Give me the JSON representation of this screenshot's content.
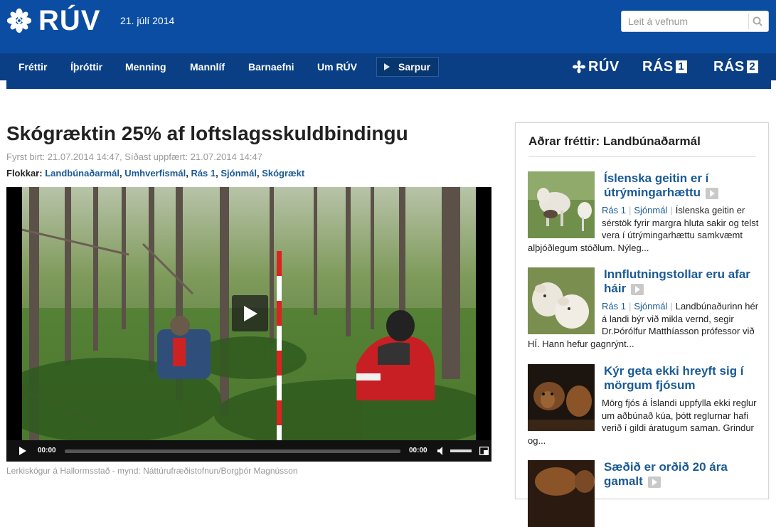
{
  "header": {
    "logo_text": "RÚV",
    "date": "21. júlí 2014",
    "search_placeholder": "Leit á vefnum"
  },
  "nav": {
    "items": [
      "Fréttir",
      "Íþróttir",
      "Menning",
      "Mannlíf",
      "Barnaefni",
      "Um RÚV"
    ],
    "sarpur": "Sarpur",
    "brands": {
      "ruv": "RÚV",
      "ras1": "RÁS",
      "ras1_num": "1",
      "ras2": "RÁS",
      "ras2_num": "2"
    }
  },
  "article": {
    "title": "Skógræktin 25% af loftslagsskuldbindingu",
    "meta": "Fyrst birt: 21.07.2014 14:47, Síðast uppfært: 21.07.2014 14:47",
    "categories_label": "Flokkar:",
    "categories": [
      "Landbúnaðarmál",
      "Umhverfismál",
      "Rás 1",
      "Sjónmál",
      "Skógrækt"
    ],
    "video": {
      "time_current": "00:00",
      "time_total": "00:00",
      "progress": 0
    },
    "caption": "Lerkiskógur á Hallormsstað - mynd: Náttúrufræðistofnun/Borgþór Magnússon"
  },
  "sidebar": {
    "title": "Aðrar fréttir: Landbúnaðarmál",
    "stories": [
      {
        "title": "Íslenska geitin er í útrýmingarhættu",
        "tags": [
          "Rás 1",
          "Sjónmál"
        ],
        "body": "Íslenska geitin er sérstök fyrir margra hluta sakir og telst vera í útrýmingarhættu samkvæmt alþjóðlegum stöðlum. Nýleg..."
      },
      {
        "title": "Innflutningstollar eru afar háir",
        "tags": [
          "Rás 1",
          "Sjónmál"
        ],
        "body": "Landbúnaðurinn hér á landi býr við mikla vernd, segir Dr.Þórólfur Matthíasson prófessor við HÍ. Hann hefur gagnrýnt..."
      },
      {
        "title": "Kýr geta ekki hreyft sig í mörgum fjósum",
        "tags": [],
        "body": "Mörg fjós á Íslandi uppfylla ekki reglur um aðbúnað kúa, þótt reglurnar hafi verið í gildi áratugum saman. Grindur og..."
      },
      {
        "title": "Sæðið er orðið 20 ára gamalt",
        "tags": [],
        "body": ""
      }
    ]
  },
  "colors": {
    "brand_blue": "#0b4da2",
    "nav_blue": "#0a3f86",
    "link_blue": "#1a5a96"
  }
}
